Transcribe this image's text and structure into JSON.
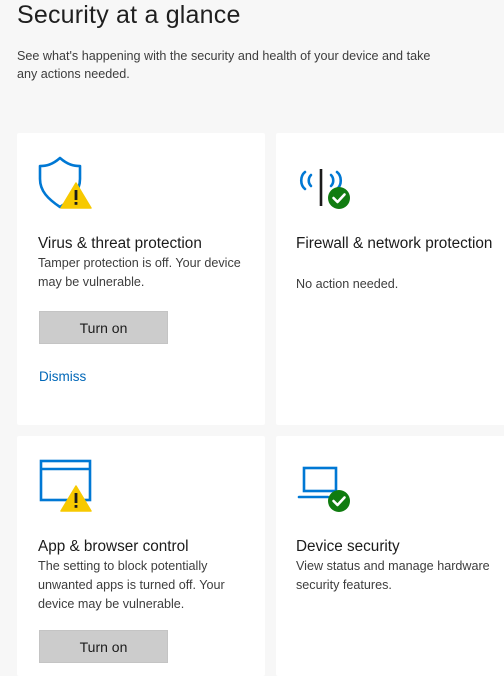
{
  "page": {
    "title": "Security at a glance",
    "subtitle": "See what's happening with the security and health of your device and take any actions needed."
  },
  "cards": [
    {
      "title": "Virus & threat protection",
      "description": "Tamper protection is off. Your device may be vulnerable.",
      "status": "warning",
      "icon": "shield-warning-icon",
      "button_label": "Turn on",
      "link_label": "Dismiss"
    },
    {
      "title": "Firewall & network protection",
      "description": "No action needed.",
      "status": "ok",
      "icon": "firewall-antenna-icon"
    },
    {
      "title": "App & browser control",
      "description": "The setting to block potentially unwanted apps is turned off. Your device may be vulnerable.",
      "status": "warning",
      "icon": "browser-window-warning-icon",
      "button_label": "Turn on"
    },
    {
      "title": "Device security",
      "description": "View status and manage hardware security features.",
      "status": "ok",
      "icon": "laptop-check-icon"
    }
  ],
  "colors": {
    "icon_blue": "#0078d4",
    "warning_yellow": "#f7c900",
    "ok_green": "#107c10",
    "link_blue": "#0067b8",
    "button_gray": "#cccccc"
  }
}
